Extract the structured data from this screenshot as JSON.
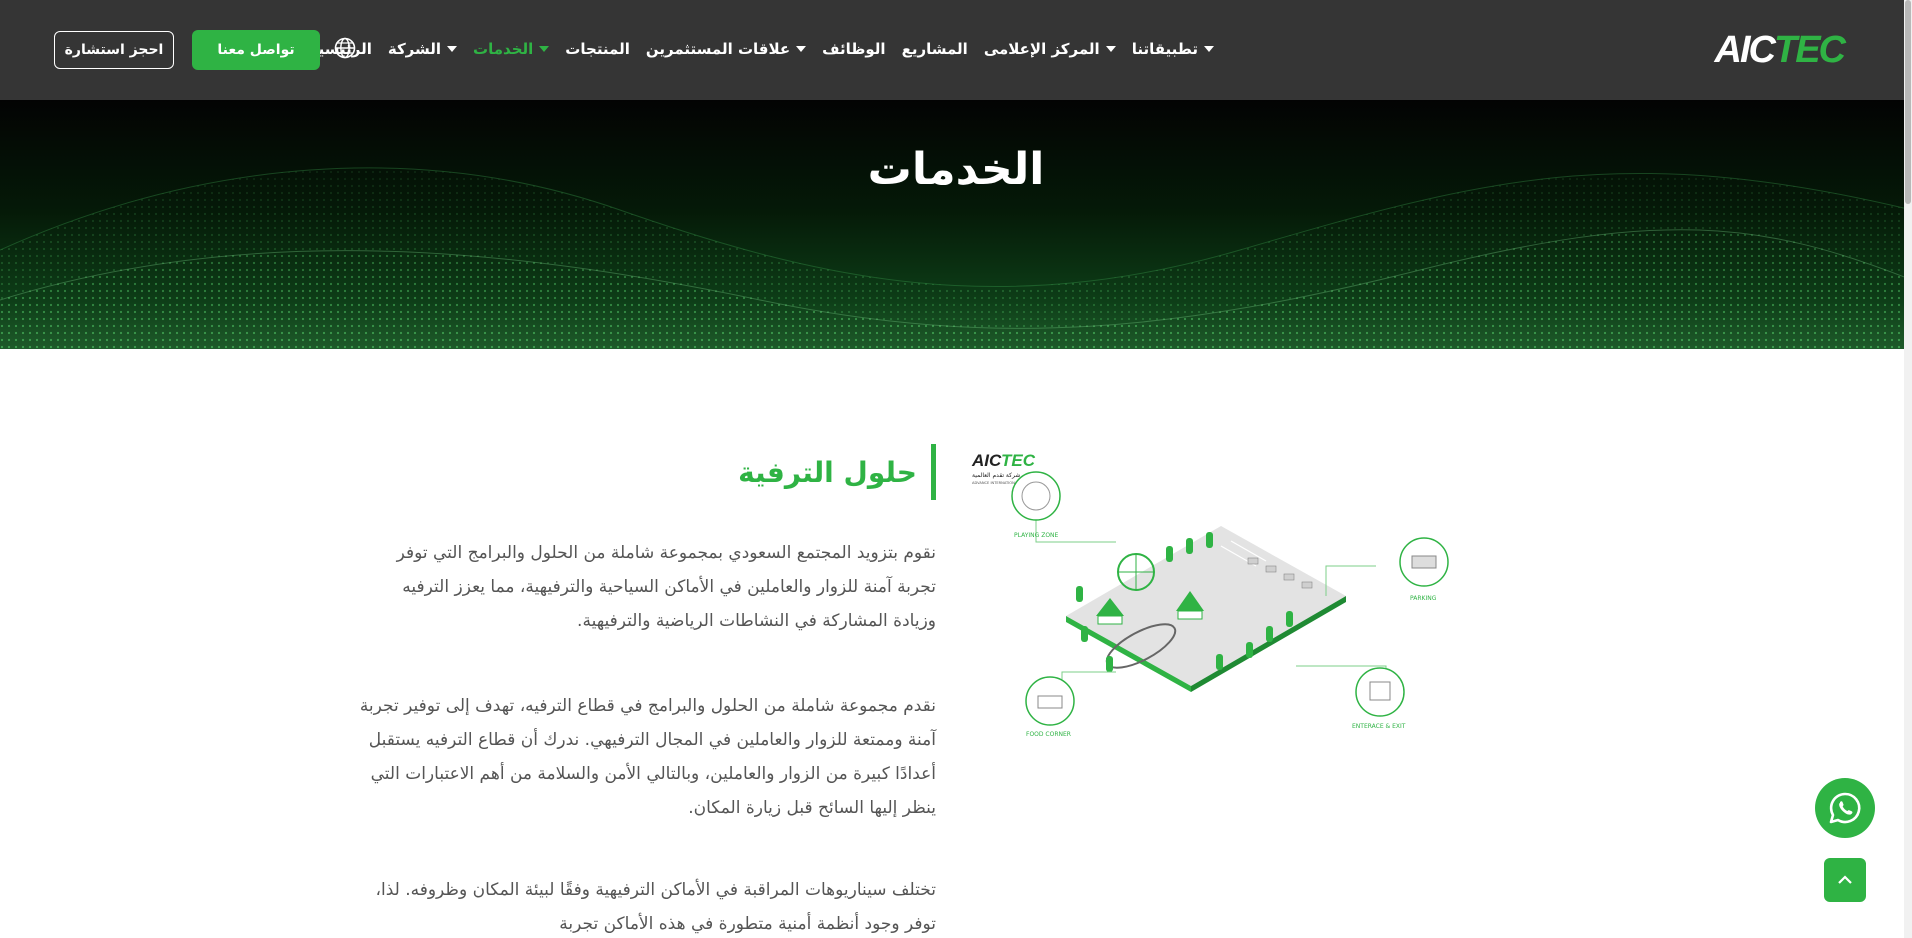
{
  "header": {
    "logo_main": "AIC",
    "logo_accent": "TEC",
    "nav": [
      {
        "label": "الرئيسية",
        "dropdown": false,
        "active": false
      },
      {
        "label": "الشركة",
        "dropdown": true,
        "active": false
      },
      {
        "label": "الخدمات",
        "dropdown": true,
        "active": true
      },
      {
        "label": "المنتجات",
        "dropdown": false,
        "active": false
      },
      {
        "label": "علاقات المستثمرين",
        "dropdown": true,
        "active": false
      },
      {
        "label": "الوظائف",
        "dropdown": false,
        "active": false
      },
      {
        "label": "المشاريع",
        "dropdown": false,
        "active": false
      },
      {
        "label": "المركز الإعلامى",
        "dropdown": true,
        "active": false
      },
      {
        "label": "تطبيقاتنا",
        "dropdown": true,
        "active": false
      }
    ],
    "contact_button": "تواصل معنا",
    "consult_button": "احجز استشارة",
    "language_icon": "globe-icon"
  },
  "hero": {
    "title": "الخدمات"
  },
  "section": {
    "title": "حلول الترفية",
    "paragraphs": [
      "نقوم بتزويد المجتمع السعودي بمجموعة شاملة من الحلول والبرامج التي توفر تجربة آمنة للزوار والعاملين في الأماكن السياحية والترفيهية، مما يعزز الترفيه وزيادة المشاركة في النشاطات الرياضية والترفيهية.",
      "نقدم مجموعة شاملة من الحلول والبرامج في قطاع الترفيه، تهدف إلى توفير تجربة آمنة وممتعة للزوار والعاملين في المجال الترفيهي. ندرك أن قطاع الترفيه يستقبل أعدادًا كبيرة من الزوار والعاملين، وبالتالي الأمن والسلامة من أهم الاعتبارات التي ينظر إليها السائح قبل زيارة المكان.",
      "تختلف سيناريوهات المراقبة في الأماكن الترفيهية وفقًا لبيئة المكان وظروفه. لذا، توفر وجود أنظمة أمنية متطورة في هذه الأماكن تجربة"
    ]
  },
  "illustration": {
    "logo_main": "AIC",
    "logo_accent": "TEC",
    "company_ar": "شركة تقدم العالمية",
    "company_en": "ADVANCE INTERNATIONAL CO.",
    "zones": [
      "PLAYING ZONE",
      "PARKING",
      "FOOD CORNER",
      "ENTERACE & EXIT"
    ]
  },
  "colors": {
    "accent": "#2fb344",
    "header_bg": "#353535",
    "text": "#555555"
  }
}
